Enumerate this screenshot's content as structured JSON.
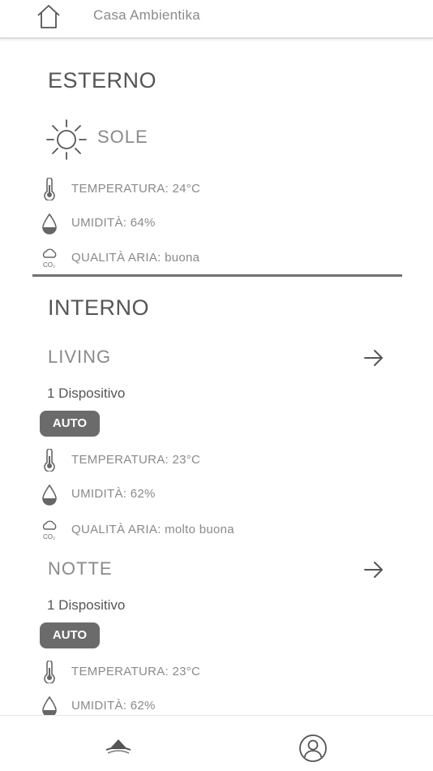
{
  "header": {
    "title": "Casa Ambientika"
  },
  "esterno": {
    "title": "ESTERNO",
    "weather": {
      "icon": "sun-icon",
      "label": "SOLE"
    },
    "metrics": [
      {
        "icon": "thermometer-icon",
        "text": "TEMPERATURA: 24°C"
      },
      {
        "icon": "droplet-icon",
        "text": "UMIDITÀ: 64%"
      },
      {
        "icon": "air-quality-icon",
        "text": "QUALITÀ ARIA: buona"
      }
    ]
  },
  "interno": {
    "title": "INTERNO",
    "rooms": [
      {
        "name": "LIVING",
        "devices": "1 Dispositivo",
        "mode": "AUTO",
        "metrics": [
          {
            "icon": "thermometer-icon",
            "text": "TEMPERATURA: 23°C"
          },
          {
            "icon": "droplet-icon",
            "text": "UMIDITÀ: 62%"
          },
          {
            "icon": "air-quality-icon",
            "text": "QUALITÀ ARIA: molto buona"
          }
        ]
      },
      {
        "name": "NOTTE",
        "devices": "1 Dispositivo",
        "mode": "AUTO",
        "metrics": [
          {
            "icon": "thermometer-icon",
            "text": "TEMPERATURA: 23°C"
          },
          {
            "icon": "droplet-icon",
            "text": "UMIDITÀ: 62%"
          }
        ]
      }
    ]
  },
  "nav": {
    "items": [
      {
        "icon": "ambientika-logo-icon"
      },
      {
        "icon": "profile-icon"
      }
    ]
  }
}
